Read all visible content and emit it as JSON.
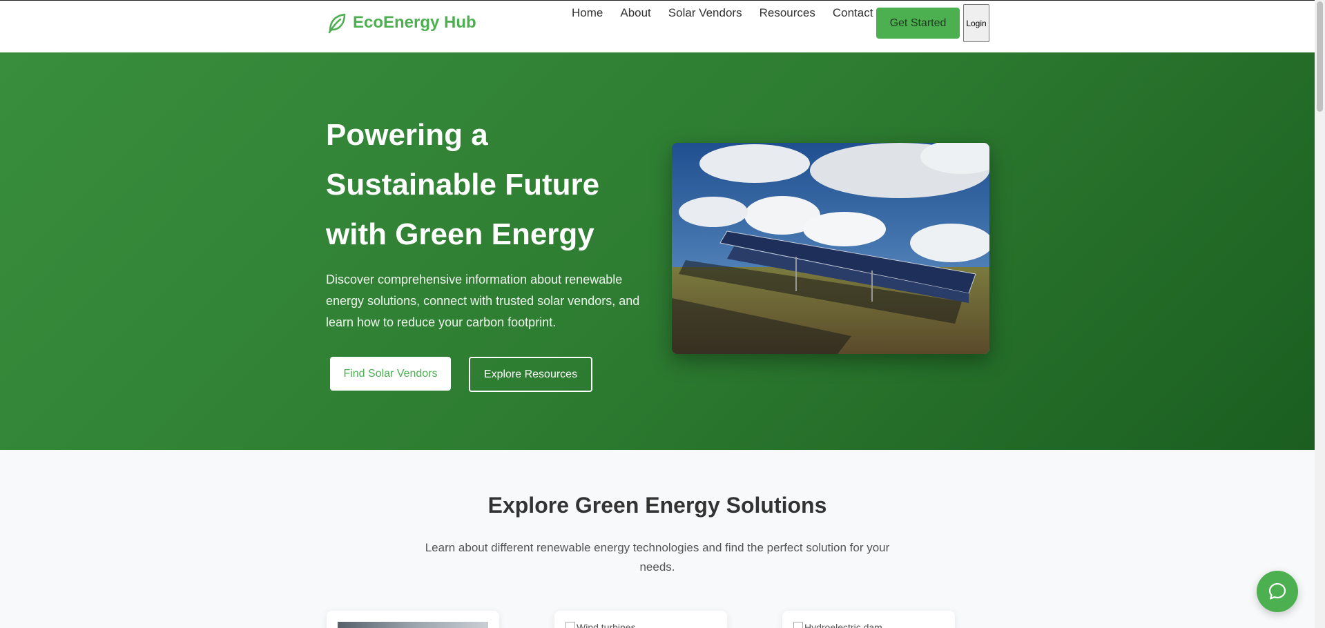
{
  "header": {
    "logo_text": "EcoEnergy Hub",
    "logo_icon": "leaf-icon",
    "nav": [
      "Home",
      "About",
      "Solar Vendors",
      "Resources",
      "Contact"
    ],
    "get_started": "Get Started",
    "login": "Login"
  },
  "hero": {
    "title": "Powering a Sustainable Future with Green Energy",
    "description": "Discover comprehensive information about renewable energy solutions, connect with trusted solar vendors, and learn how to reduce your carbon footprint.",
    "primary_button": "Find Solar Vendors",
    "secondary_button": "Explore Resources",
    "image": "solar-panels-field"
  },
  "solutions": {
    "title": "Explore Green Energy Solutions",
    "description": "Learn about different renewable energy technologies and find the perfect solution for your needs.",
    "cards": [
      {
        "image": "solar-thumbnail",
        "alt": ""
      },
      {
        "image": "wind-thumbnail",
        "alt": "Wind turbines"
      },
      {
        "image": "hydro-thumbnail",
        "alt": "Hydroelectric dam"
      }
    ]
  },
  "chat": {
    "icon": "chat-bubble-icon"
  },
  "colors": {
    "brand": "#4caf50",
    "hero_start": "#388e3c",
    "hero_end": "#1b5e20"
  }
}
